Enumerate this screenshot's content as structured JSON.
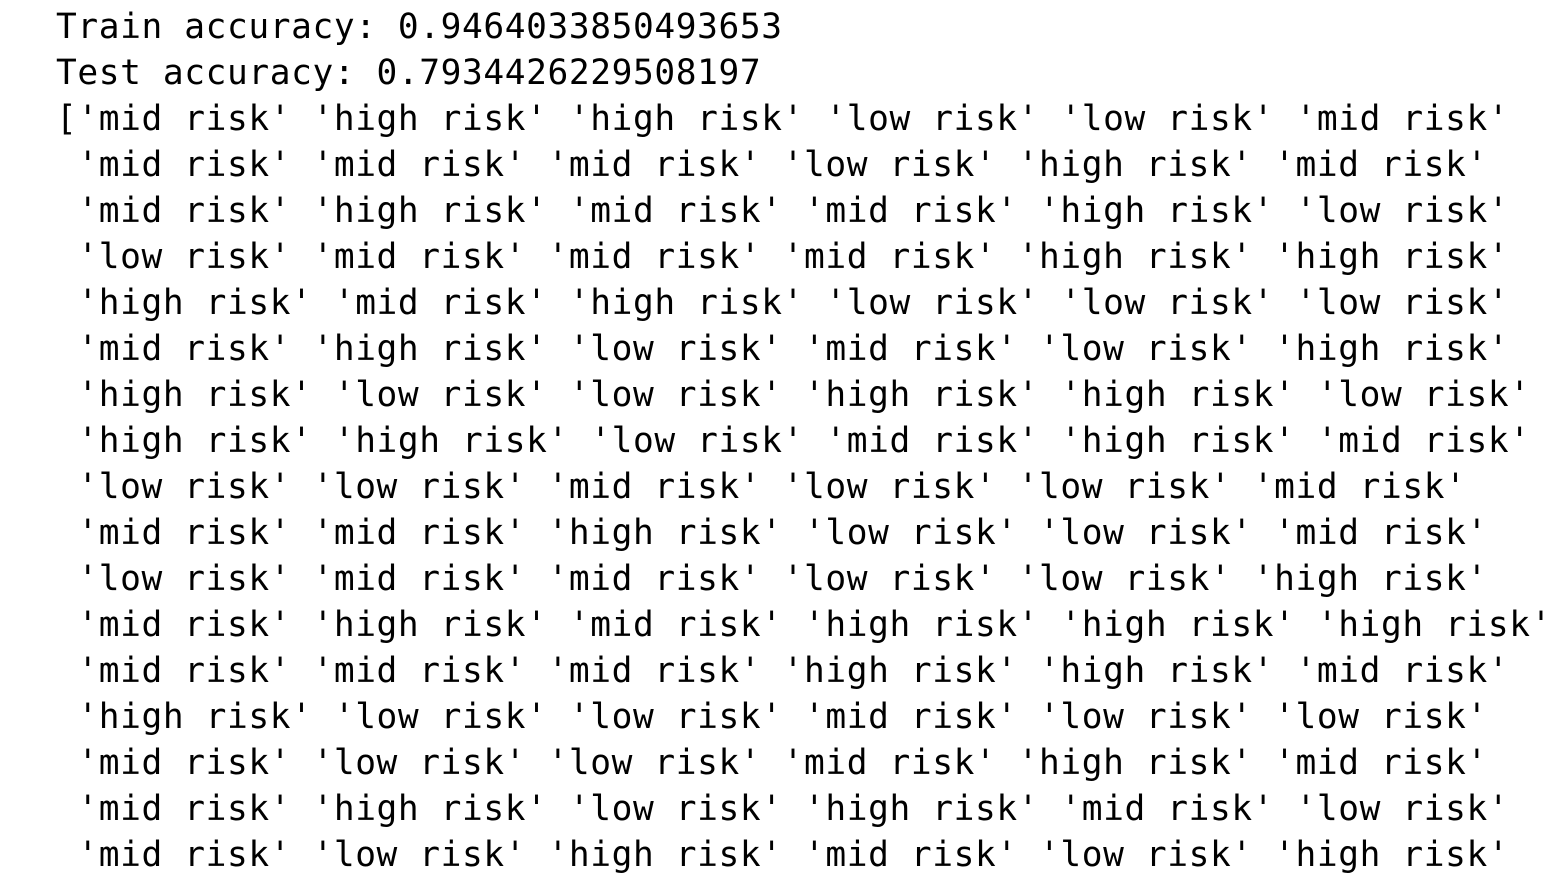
{
  "output": {
    "lines": [
      "Train accuracy: 0.9464033850493653",
      "Test accuracy: 0.7934426229508197",
      "['mid risk' 'high risk' 'high risk' 'low risk' 'low risk' 'mid risk'",
      " 'mid risk' 'mid risk' 'mid risk' 'low risk' 'high risk' 'mid risk'",
      " 'mid risk' 'high risk' 'mid risk' 'mid risk' 'high risk' 'low risk'",
      " 'low risk' 'mid risk' 'mid risk' 'mid risk' 'high risk' 'high risk'",
      " 'high risk' 'mid risk' 'high risk' 'low risk' 'low risk' 'low risk'",
      " 'mid risk' 'high risk' 'low risk' 'mid risk' 'low risk' 'high risk'",
      " 'high risk' 'low risk' 'low risk' 'high risk' 'high risk' 'low risk'",
      " 'high risk' 'high risk' 'low risk' 'mid risk' 'high risk' 'mid risk'",
      " 'low risk' 'low risk' 'mid risk' 'low risk' 'low risk' 'mid risk'",
      " 'mid risk' 'mid risk' 'high risk' 'low risk' 'low risk' 'mid risk'",
      " 'low risk' 'mid risk' 'mid risk' 'low risk' 'low risk' 'high risk'",
      " 'mid risk' 'high risk' 'mid risk' 'high risk' 'high risk' 'high risk'",
      " 'mid risk' 'mid risk' 'mid risk' 'high risk' 'high risk' 'mid risk'",
      " 'high risk' 'low risk' 'low risk' 'mid risk' 'low risk' 'low risk'",
      " 'mid risk' 'low risk' 'low risk' 'mid risk' 'high risk' 'mid risk'",
      " 'mid risk' 'high risk' 'low risk' 'high risk' 'mid risk' 'low risk'",
      " 'mid risk' 'low risk' 'high risk' 'mid risk' 'low risk' 'high risk'"
    ]
  }
}
